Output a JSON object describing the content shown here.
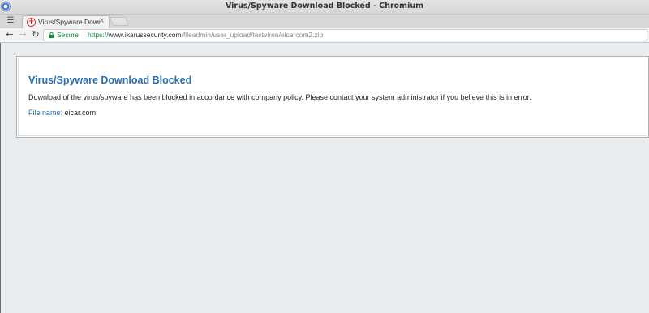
{
  "window": {
    "title": "Virus/Spyware Download Blocked - Chromium",
    "app_icon": "chromium-logo-icon"
  },
  "tabstrip": {
    "menu_icon": "tab-menu-icon",
    "tabs": [
      {
        "title": "Virus/Spyware Downlo",
        "favicon": "blocked-favicon-icon",
        "close_glyph": "×",
        "active": true
      }
    ],
    "new_tab_icon": "new-tab-icon"
  },
  "toolbar": {
    "back_glyph": "←",
    "forward_glyph": "→",
    "reload_glyph": "↻",
    "security_label": "Secure",
    "url_scheme": "https://",
    "url_host": "www.ikarussecurity.com",
    "url_path": "/fileadmin/user_upload/testviren/eicarcom2.zip",
    "secure_color": "#118c3a"
  },
  "page": {
    "heading": "Virus/Spyware Download Blocked",
    "message": "Download of the virus/spyware has been blocked in accordance with company policy. Please contact your system administrator if you believe this is in error.",
    "file_label": "File name:",
    "file_name": "eicar.com",
    "accent_color": "#2a6fb0",
    "background_color": "#e8ecef"
  }
}
